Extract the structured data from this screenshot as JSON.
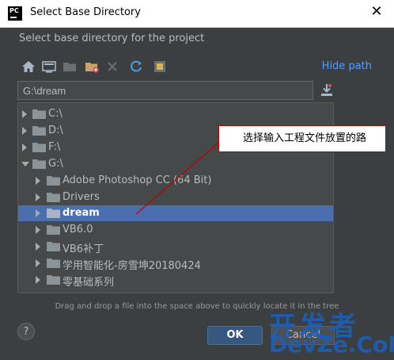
{
  "window": {
    "title": "Select Base Directory",
    "close_glyph": "✕"
  },
  "dialog": {
    "subtitle": "Select base directory for the project",
    "hide_path_label": "Hide path",
    "path_value": "G:\\dream",
    "hint": "Drag and drop a file into the space above to quickly locate it in the tree",
    "help_label": "?",
    "ok_label": "OK",
    "cancel_label": "Cancel"
  },
  "toolbar": {
    "icons": [
      "home-icon",
      "desktop-icon",
      "project-folder-icon",
      "new-folder-icon",
      "delete-icon",
      "refresh-icon",
      "show-hidden-icon"
    ]
  },
  "tree": {
    "items": [
      {
        "label": "C:\\",
        "level": 0,
        "expanded": false,
        "selected": false
      },
      {
        "label": "D:\\",
        "level": 0,
        "expanded": false,
        "selected": false
      },
      {
        "label": "F:\\",
        "level": 0,
        "expanded": false,
        "selected": false
      },
      {
        "label": "G:\\",
        "level": 0,
        "expanded": true,
        "selected": false
      },
      {
        "label": "Adobe Photoshop CC (64 Bit)",
        "level": 1,
        "expanded": false,
        "selected": false
      },
      {
        "label": "Drivers",
        "level": 1,
        "expanded": false,
        "selected": false
      },
      {
        "label": "dream",
        "level": 1,
        "expanded": false,
        "selected": true
      },
      {
        "label": "VB6.0",
        "level": 1,
        "expanded": false,
        "selected": false
      },
      {
        "label": "VB6补丁",
        "level": 1,
        "expanded": false,
        "selected": false
      },
      {
        "label": "学用智能化-房雪坤20180424",
        "level": 1,
        "expanded": false,
        "selected": false
      },
      {
        "label": "零基础系列",
        "level": 1,
        "expanded": false,
        "selected": false
      }
    ]
  },
  "annotation": {
    "text": "选择输入工程文件放置的路"
  },
  "watermark": {
    "line1": "开发者",
    "line2": "DevZe.CoM"
  },
  "colors": {
    "background": "#3c3f41",
    "selection": "#4b6eaf",
    "link": "#589df6",
    "ok_button": "#365880",
    "folder": "#8a9499",
    "annotation_border": "#c00000"
  }
}
